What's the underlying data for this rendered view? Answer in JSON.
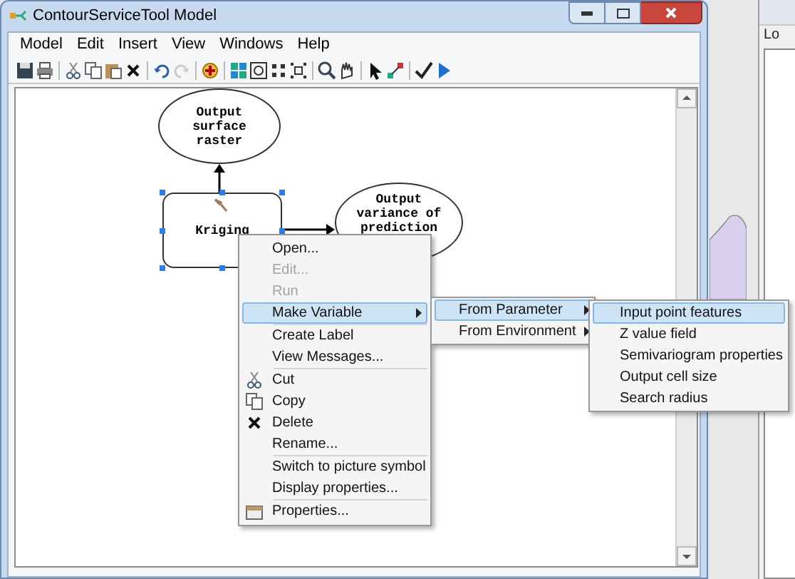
{
  "window": {
    "title": "ContourServiceTool Model"
  },
  "menu_bar": [
    "Model",
    "Edit",
    "Insert",
    "View",
    "Windows",
    "Help"
  ],
  "toolbar": [
    {
      "disabled": false
    },
    {
      "disabled": false
    },
    {
      "disabled": false
    },
    {
      "disabled": false
    },
    {
      "disabled": false
    },
    {
      "disabled": false
    },
    {
      "disabled": false
    },
    {
      "disabled": true
    },
    {
      "disabled": false
    },
    {
      "disabled": false
    },
    {
      "disabled": false
    },
    {
      "disabled": false
    },
    {
      "disabled": false
    },
    {
      "disabled": false
    },
    {
      "disabled": false
    },
    {
      "disabled": false
    },
    {
      "disabled": false
    },
    {
      "disabled": false
    },
    {
      "disabled": false
    }
  ],
  "diagram": {
    "nodes": [
      {
        "kind": "ellipse",
        "lines": [
          "Output",
          "surface",
          "raster"
        ],
        "selected": false
      },
      {
        "kind": "tool",
        "lines": [
          "Kriging"
        ],
        "selected": true
      },
      {
        "kind": "ellipse",
        "lines": [
          "Output",
          "variance of",
          "prediction"
        ],
        "selected": false
      }
    ]
  },
  "context_menu": {
    "items": [
      {
        "kind": "item",
        "label": "Open...",
        "disabled": false,
        "selected": false,
        "submenu": false
      },
      {
        "kind": "item",
        "label": "Edit...",
        "disabled": true,
        "selected": false,
        "submenu": false
      },
      {
        "kind": "item",
        "label": "Run",
        "disabled": true,
        "selected": false,
        "submenu": false
      },
      {
        "kind": "item",
        "label": "Make Variable",
        "disabled": false,
        "selected": true,
        "submenu": true
      },
      {
        "kind": "separator"
      },
      {
        "kind": "item",
        "label": "Create Label",
        "disabled": false,
        "selected": false,
        "submenu": false
      },
      {
        "kind": "item",
        "label": "View Messages...",
        "disabled": false,
        "selected": false,
        "submenu": false
      },
      {
        "kind": "separator"
      },
      {
        "kind": "item",
        "label": "Cut",
        "disabled": false,
        "selected": false,
        "submenu": false
      },
      {
        "kind": "item",
        "label": "Copy",
        "disabled": false,
        "selected": false,
        "submenu": false
      },
      {
        "kind": "item",
        "label": "Delete",
        "disabled": false,
        "selected": false,
        "submenu": false
      },
      {
        "kind": "item",
        "label": "Rename...",
        "disabled": false,
        "selected": false,
        "submenu": false
      },
      {
        "kind": "separator"
      },
      {
        "kind": "item",
        "label": "Switch to picture symbol",
        "disabled": false,
        "selected": false,
        "submenu": false
      },
      {
        "kind": "item",
        "label": "Display properties...",
        "disabled": false,
        "selected": false,
        "submenu": false
      },
      {
        "kind": "separator"
      },
      {
        "kind": "item",
        "label": "Properties...",
        "disabled": false,
        "selected": false,
        "submenu": false
      }
    ]
  },
  "submenu": {
    "items": [
      {
        "label": "From Parameter",
        "selected": true,
        "submenu": true
      },
      {
        "label": "From Environment",
        "selected": false,
        "submenu": true
      }
    ]
  },
  "parameter_menu": {
    "items": [
      {
        "label": "Input point features",
        "selected": true
      },
      {
        "label": "Z value field",
        "selected": false
      },
      {
        "label": "Semivariogram properties",
        "selected": false
      },
      {
        "label": "Output cell size",
        "selected": false
      },
      {
        "label": "Search radius",
        "selected": false
      }
    ]
  },
  "side_panel": {
    "label": "Lo"
  }
}
